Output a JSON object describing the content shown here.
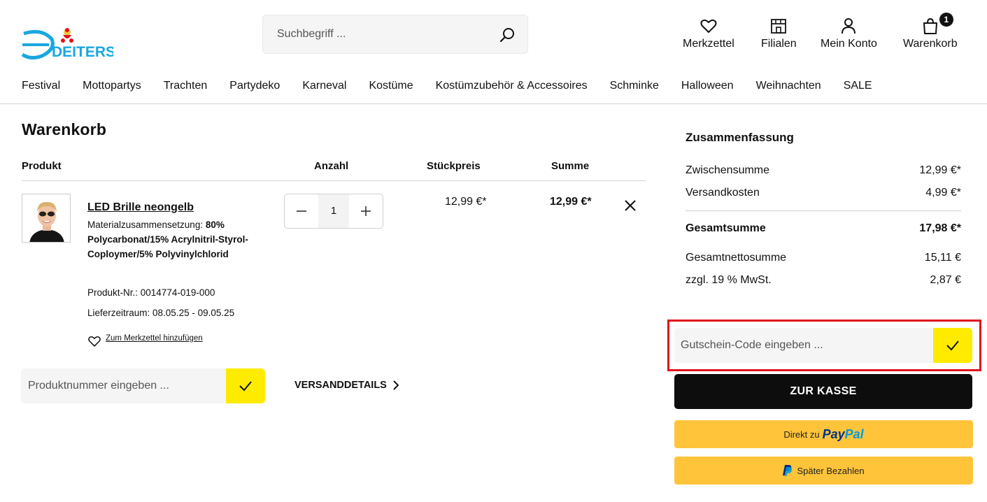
{
  "brand": {
    "logo_text": "DEITERS"
  },
  "search": {
    "placeholder": "Suchbegriff ..."
  },
  "header_icons": {
    "wishlist": "Merkzettel",
    "stores": "Filialen",
    "account": "Mein Konto",
    "cart": "Warenkorb",
    "cart_count": "1"
  },
  "nav": [
    "Festival",
    "Mottopartys",
    "Trachten",
    "Partydeko",
    "Karneval",
    "Kostüme",
    "Kostümzubehör & Accessoires",
    "Schminke",
    "Halloween",
    "Weihnachten",
    "SALE"
  ],
  "cart": {
    "title": "Warenkorb",
    "columns": {
      "product": "Produkt",
      "quantity": "Anzahl",
      "unit_price": "Stückpreis",
      "sum": "Summe"
    },
    "item": {
      "name": "LED Brille neongelb",
      "material_label": "Materialzusammensetzung:",
      "material_value": "80% Polycarbonat/15% Acrylnitril-Styrol-Coploymer/5% Polyvinylchlorid",
      "product_no": "Produkt-Nr.: 0014774-019-000",
      "delivery": "Lieferzeitraum: 08.05.25 - 09.05.25",
      "wishlist_link": "Zum Merkzettel hinzufügen",
      "quantity": "1",
      "unit_price": "12,99 €*",
      "sum": "12,99 €*"
    },
    "product_number_input": {
      "placeholder": "Produktnummer eingeben ..."
    },
    "shipping_details": "VERSANDDETAILS"
  },
  "summary": {
    "title": "Zusammenfassung",
    "subtotal_label": "Zwischensumme",
    "subtotal": "12,99 €*",
    "shipping_label": "Versandkosten",
    "shipping": "4,99 €*",
    "total_label": "Gesamtsumme",
    "total": "17,98 €*",
    "net_label": "Gesamtnettosumme",
    "net": "15,11 €",
    "vat_label": "zzgl. 19 % MwSt.",
    "vat": "2,87 €",
    "coupon_placeholder": "Gutschein-Code eingeben ...",
    "checkout": "ZUR KASSE",
    "paypal_prefix": "Direkt zu",
    "paypal_pay": "Pay",
    "paypal_pal": "Pal",
    "paylater": "Später Bezahlen"
  },
  "colors": {
    "accent_yellow": "#ffeb00",
    "paypal_yellow": "#ffc43a",
    "highlight_red": "#e0121d",
    "logo_blue": "#1aa7e0"
  }
}
